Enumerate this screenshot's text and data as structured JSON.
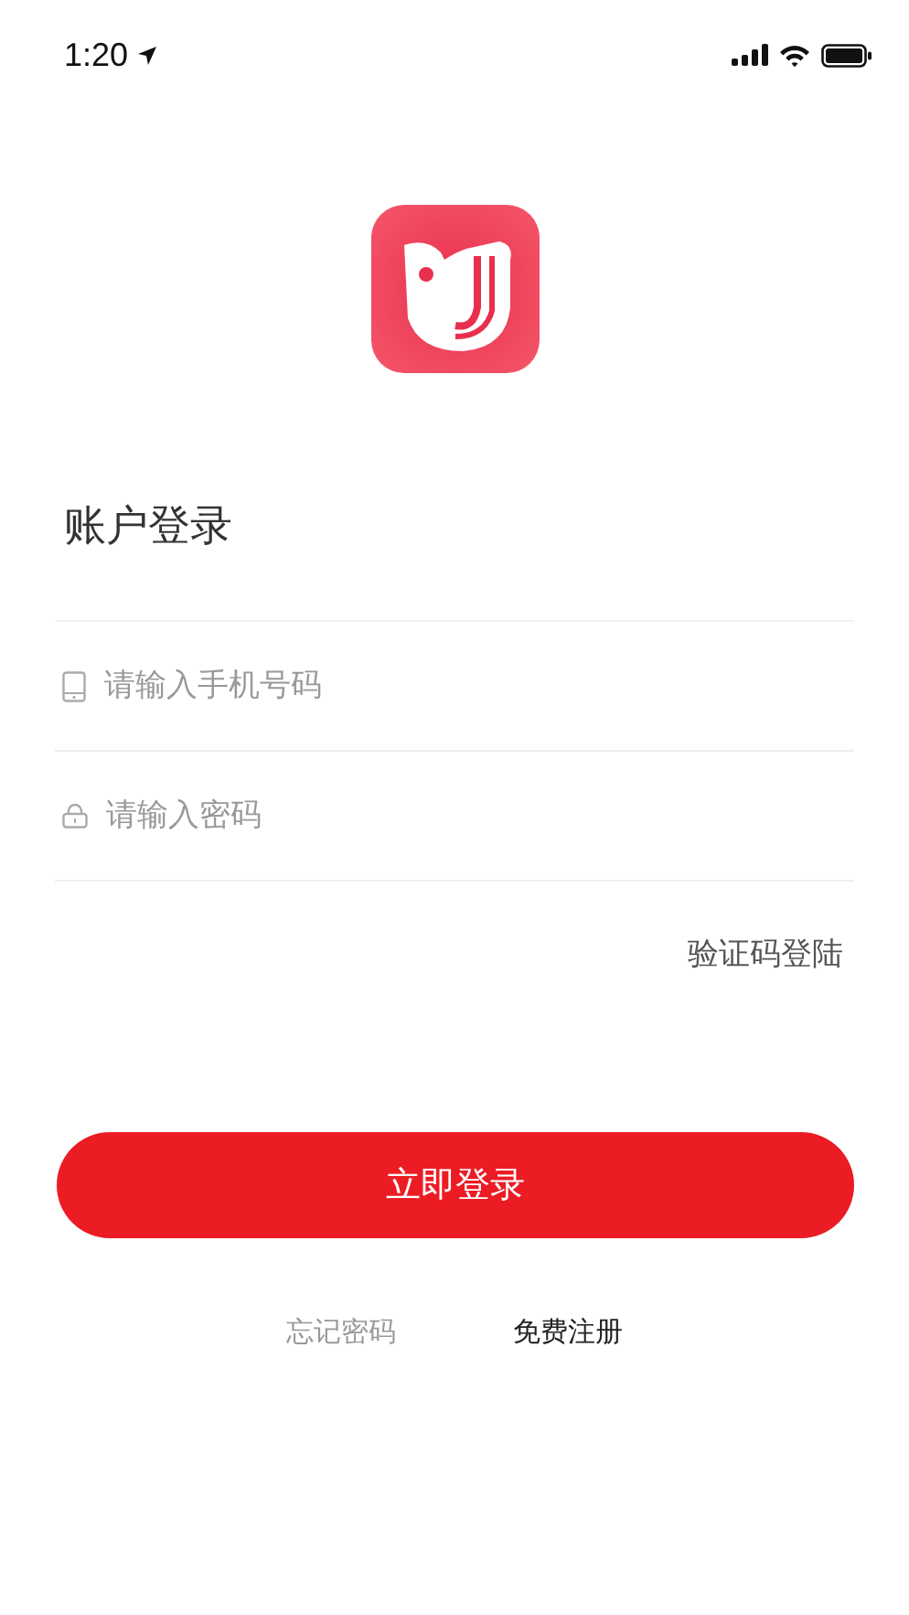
{
  "status_bar": {
    "time": "1:20"
  },
  "title": "账户登录",
  "fields": [
    {
      "kind": "phone",
      "placeholder": "请输入手机号码"
    },
    {
      "kind": "password",
      "placeholder": "请输入密码"
    }
  ],
  "alt_login_link": "验证码登陆",
  "login_button": "立即登录",
  "footer_links": [
    {
      "label": "忘记密码",
      "emphasized": false
    },
    {
      "label": "免费注册",
      "emphasized": true
    }
  ]
}
